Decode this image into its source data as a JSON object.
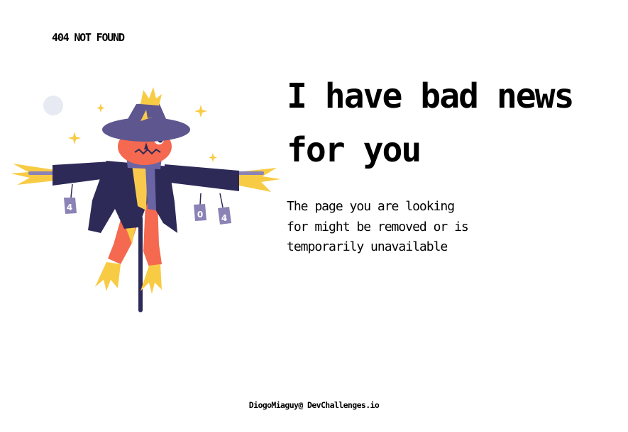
{
  "header": {
    "brand": "404 NOT FOUND"
  },
  "illustration": {
    "subject": "scarecrow",
    "can_labels": [
      "4",
      "0",
      "4"
    ]
  },
  "main": {
    "headline": "I have bad news\nfor you",
    "body": "The page you are looking\nfor might be removed or is\ntemporarily unavailable"
  },
  "footer": {
    "credit": "DiogoMiaguy@ DevChallenges.io"
  },
  "colors": {
    "hat": "#5E568F",
    "coat": "#2E2A58",
    "face": "#F4694F",
    "straw": "#F8CB45",
    "scarf_purple": "#6A64A4",
    "scarf_yellow": "#F8C94D",
    "can": "#8B82B5",
    "moon": "#E8EAF3",
    "text": "#000000"
  }
}
